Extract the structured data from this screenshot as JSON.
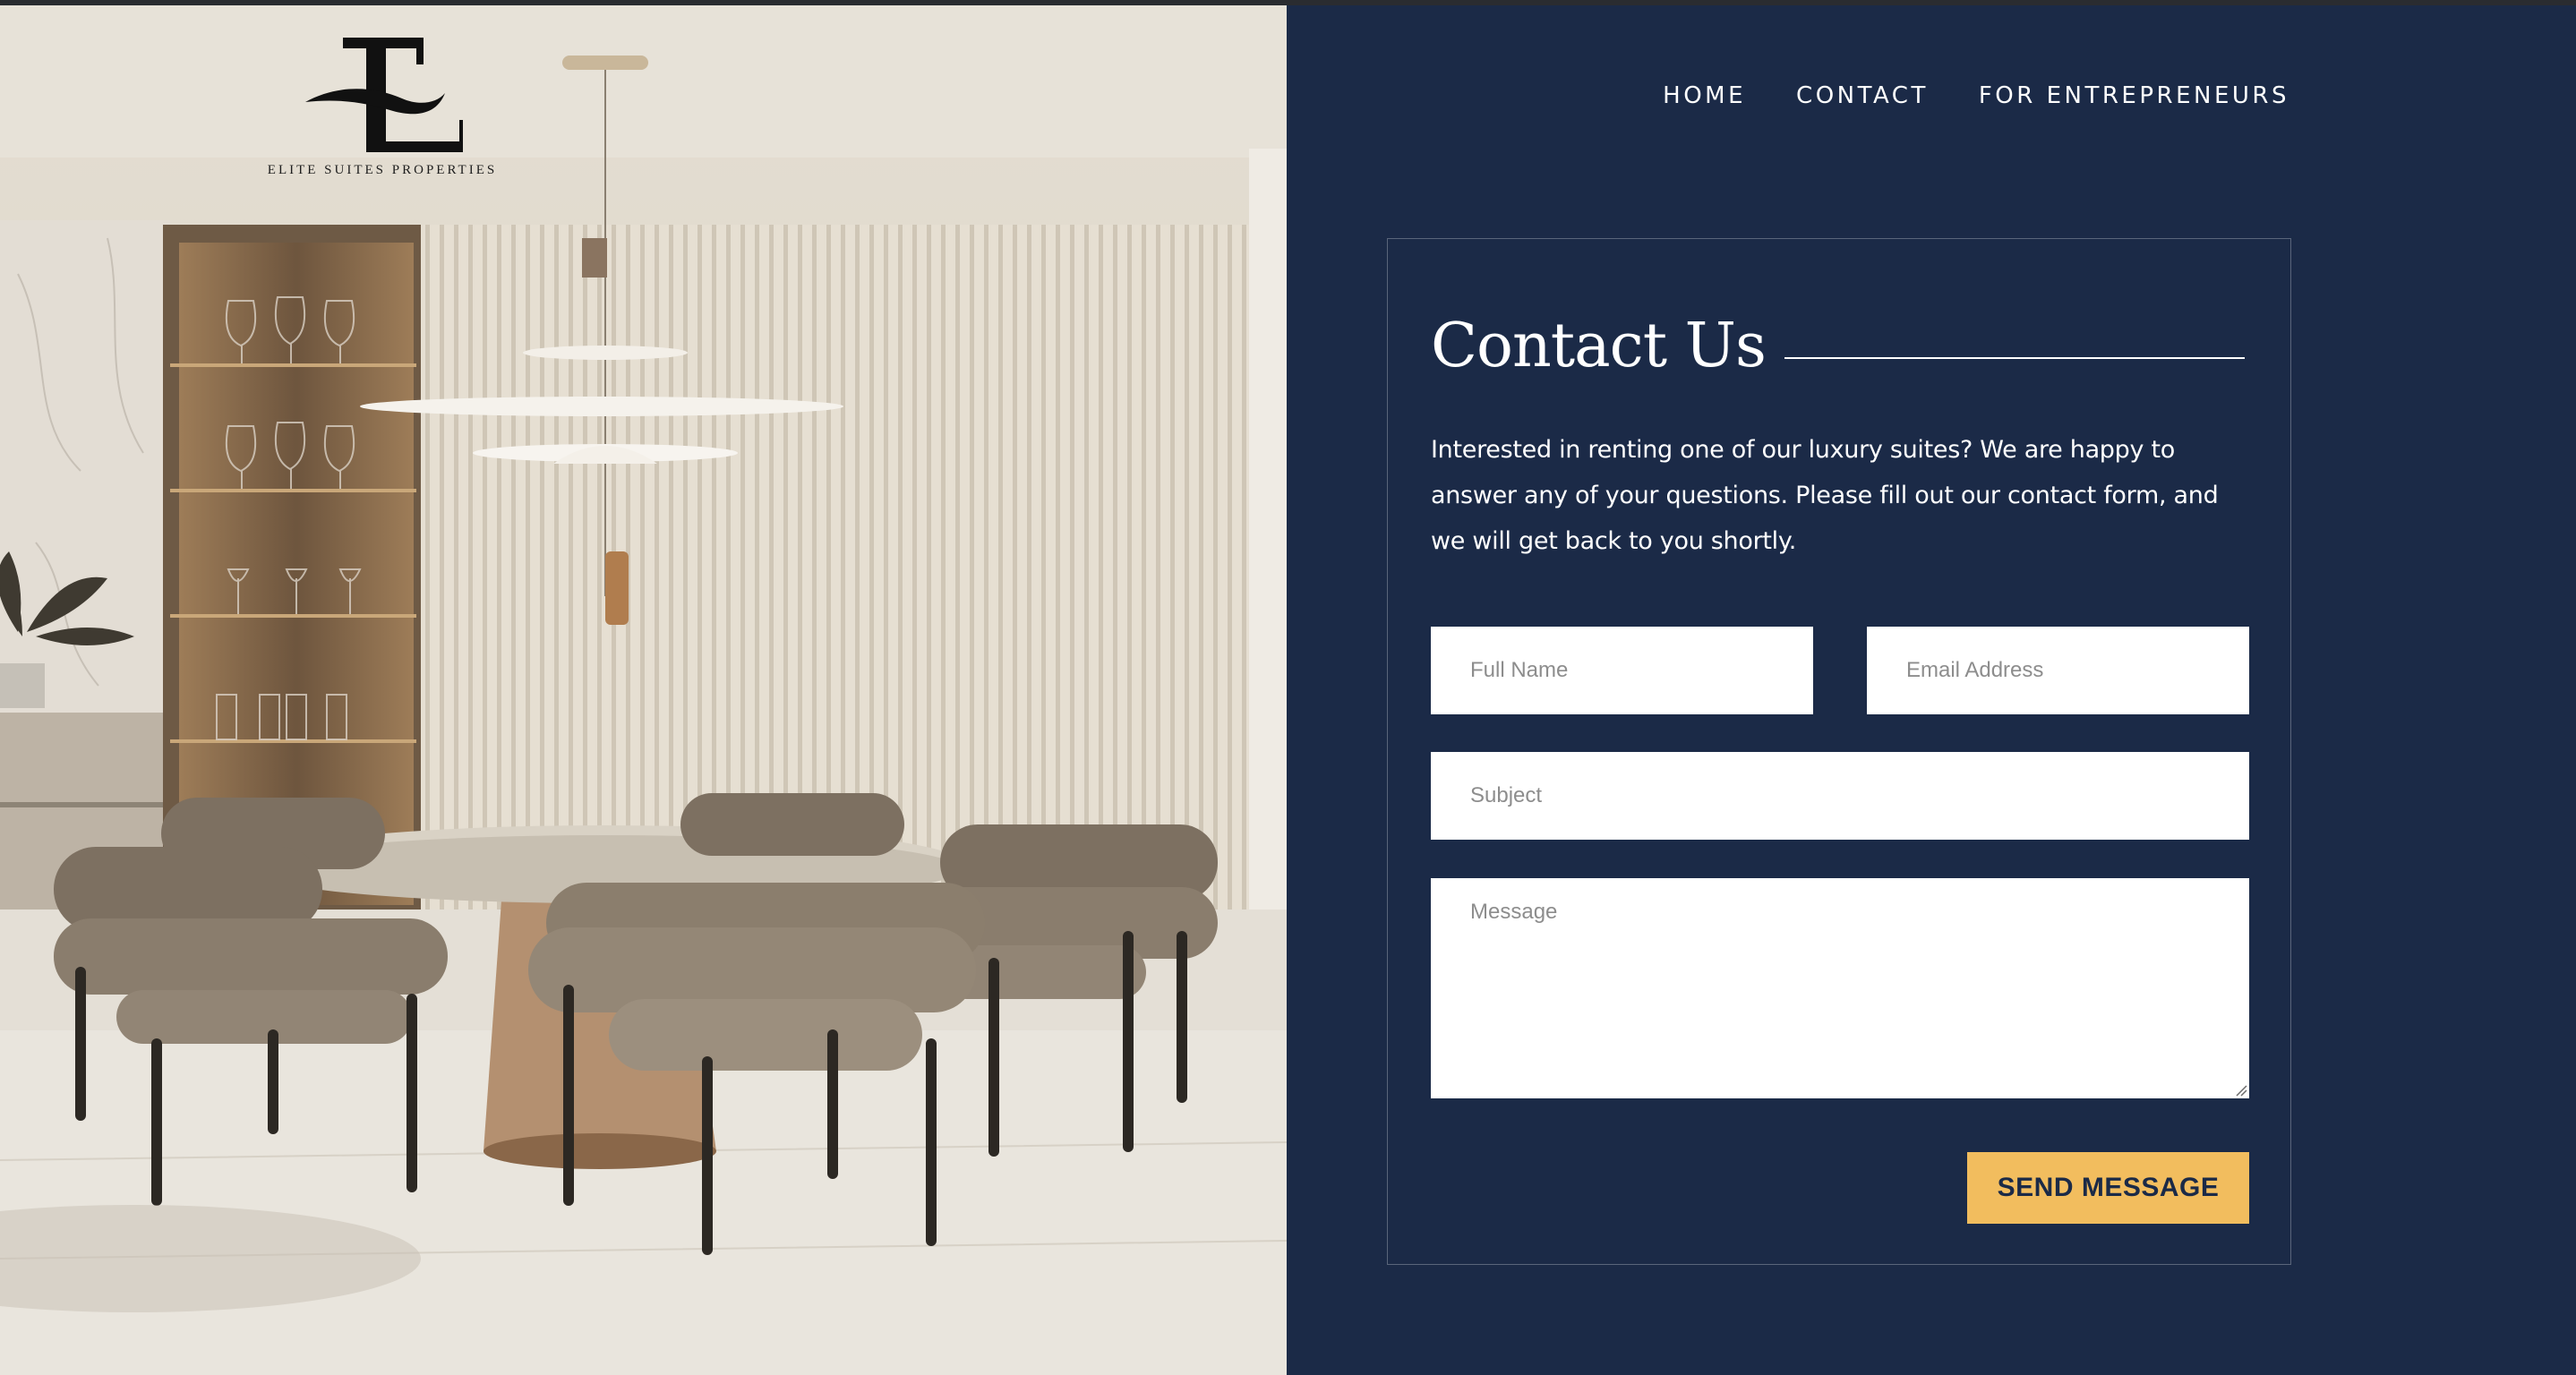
{
  "brand": {
    "logo_letter": "E",
    "name": "ELITE SUITES PROPERTIES"
  },
  "nav": {
    "items": [
      {
        "label": "HOME"
      },
      {
        "label": "CONTACT"
      },
      {
        "label": "FOR ENTREPRENEURS"
      }
    ]
  },
  "contact": {
    "title": "Contact Us",
    "intro": "Interested in renting one of our luxury suites? We are happy to answer any of your questions. Please fill out our contact form, and we will get back to you shortly.",
    "fields": {
      "full_name": {
        "placeholder": "Full Name",
        "value": ""
      },
      "email": {
        "placeholder": "Email Address",
        "value": ""
      },
      "subject": {
        "placeholder": "Subject",
        "value": ""
      },
      "message": {
        "placeholder": "Message",
        "value": ""
      }
    },
    "submit_label": "SEND MESSAGE"
  },
  "colors": {
    "panel_bg": "#1b2a47",
    "button_bg": "#f2bd5e",
    "button_text": "#1b2a47",
    "text_light": "#ffffff"
  },
  "icons": {
    "logo": "stylized-e-logo-icon",
    "textarea_grip": "resize-grip-icon"
  }
}
